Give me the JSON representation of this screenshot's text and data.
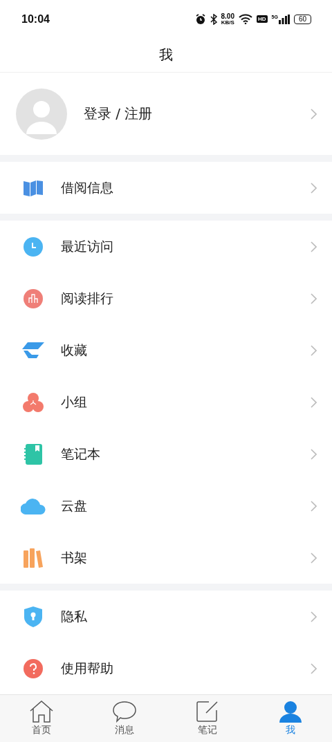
{
  "status_bar": {
    "time": "10:04",
    "speed": "8.00",
    "speed_unit": "KB/S",
    "hd": "HD",
    "network": "5G",
    "battery": "60"
  },
  "header": {
    "title": "我"
  },
  "profile": {
    "label": "登录 / 注册"
  },
  "groups": [
    {
      "items": [
        {
          "kind": "book",
          "label": "借阅信息"
        }
      ]
    },
    {
      "items": [
        {
          "kind": "clock",
          "label": "最近访问"
        },
        {
          "kind": "chart",
          "label": "阅读排行"
        },
        {
          "kind": "layers",
          "label": "收藏"
        },
        {
          "kind": "group",
          "label": "小组"
        },
        {
          "kind": "notebook",
          "label": "笔记本"
        },
        {
          "kind": "cloud",
          "label": "云盘"
        },
        {
          "kind": "shelf",
          "label": "书架"
        }
      ]
    },
    {
      "items": [
        {
          "kind": "shield",
          "label": "隐私"
        },
        {
          "kind": "help",
          "label": "使用帮助"
        }
      ]
    }
  ],
  "tabs": [
    {
      "kind": "home",
      "label": "首页",
      "selected": false
    },
    {
      "kind": "message",
      "label": "消息",
      "selected": false
    },
    {
      "kind": "note",
      "label": "笔记",
      "selected": false
    },
    {
      "kind": "me",
      "label": "我",
      "selected": true
    }
  ]
}
